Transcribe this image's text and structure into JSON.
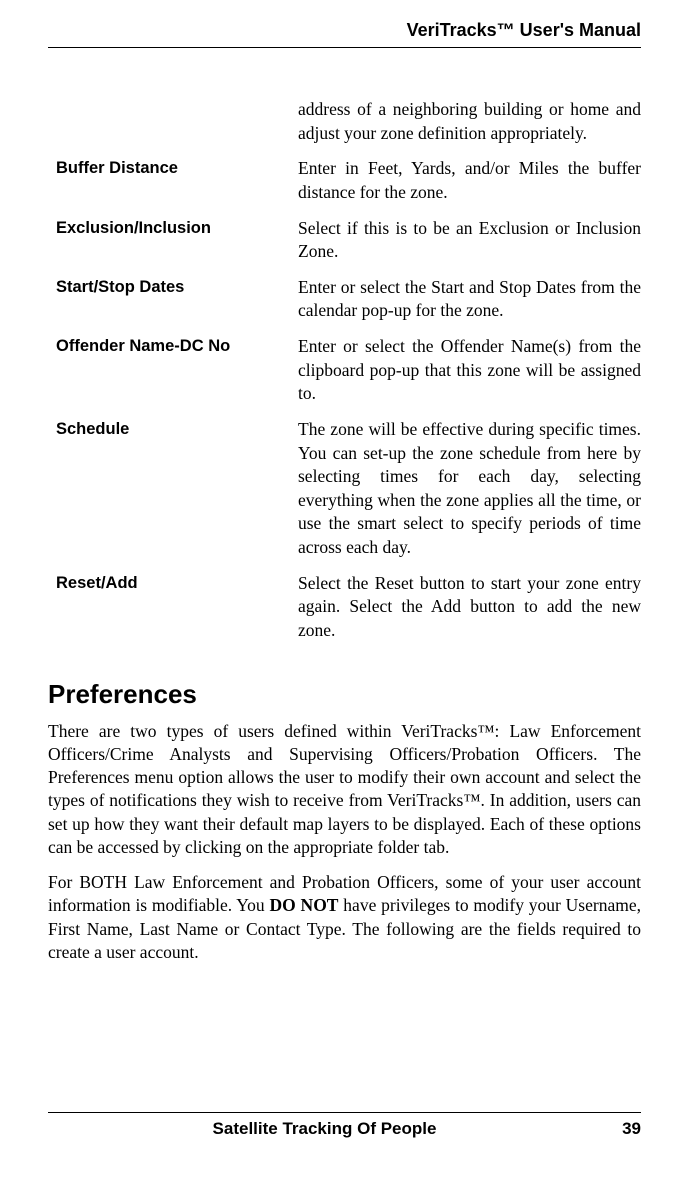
{
  "header": {
    "title": "VeriTracks™ User's Manual"
  },
  "definitions": [
    {
      "term": "",
      "desc": "address of a neighboring building or home and adjust your zone definition appropriately."
    },
    {
      "term": "Buffer Distance",
      "desc": "Enter in Feet, Yards, and/or Miles the buffer distance for the zone."
    },
    {
      "term": "Exclusion/Inclusion",
      "desc": "Select if this is to be an Exclusion or Inclusion Zone."
    },
    {
      "term": "Start/Stop Dates",
      "desc": "Enter or select the Start and Stop Dates from the calendar pop-up for the zone."
    },
    {
      "term": "Offender Name-DC No",
      "desc": "Enter or select the Offender Name(s) from the clipboard pop-up that this zone will be assigned to."
    },
    {
      "term": "Schedule",
      "desc": "The zone will be effective during specific times.  You can set-up the zone schedule from here by selecting times for each day, selecting everything when the zone applies all the time, or use the smart select to specify periods of time across each day."
    },
    {
      "term": "Reset/Add",
      "desc": "Select the Reset button to start your zone entry again.  Select the Add button to add the new zone."
    }
  ],
  "section": {
    "heading": "Preferences",
    "para1_part1": "There are two types of users defined within VeriTracks™:  Law Enforcement Officers/Crime Analysts and Supervising Officers/Probation Officers.  The Preferences menu option allows the user to modify their own account and select the types of notifications they wish to receive from VeriTracks™.  In addition, users can set up how they want their default map layers to be displayed.  Each of these options can be accessed by clicking on the appropriate folder tab.",
    "para2_part1": "For BOTH Law Enforcement and Probation Officers, some of your user account information is modifiable.  You ",
    "para2_bold": "DO NOT",
    "para2_part2": " have privileges to modify your Username, First Name, Last Name or Contact Type.  The following are the fields required to create a user account."
  },
  "footer": {
    "center": "Satellite Tracking Of People",
    "page": "39"
  }
}
